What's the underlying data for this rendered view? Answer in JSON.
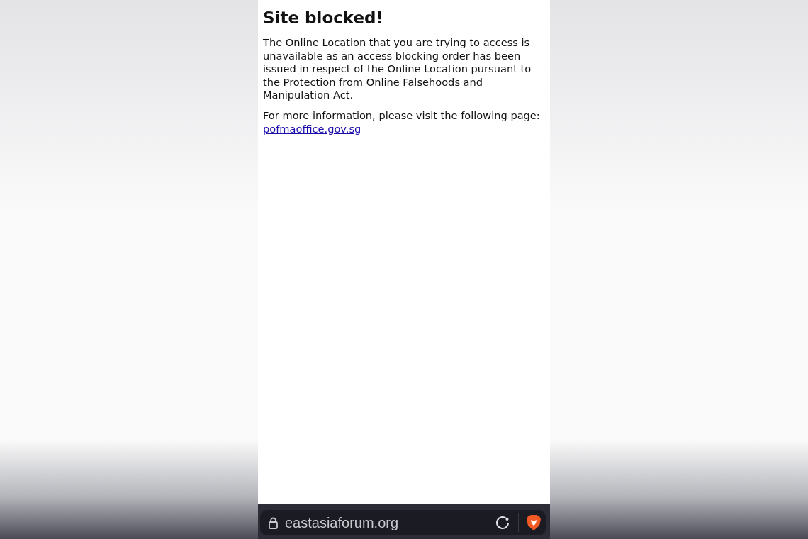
{
  "page": {
    "title": "Site blocked!",
    "paragraphs": [
      "The Online Location that you are trying to access is unavailable as an access blocking order has been issued in respect of the Online Location pursuant to the Protection from Online Falsehoods and Manipulation Act."
    ],
    "more_info": {
      "text": "For more information, please visit the following page: ",
      "link": "pofmaoffice.gov.sg"
    }
  },
  "address_bar": {
    "url": "eastasiaforum.org"
  }
}
